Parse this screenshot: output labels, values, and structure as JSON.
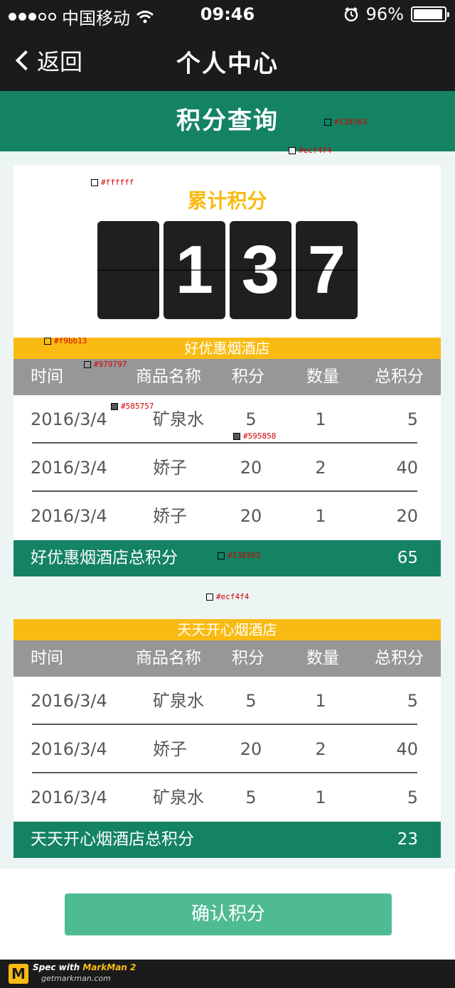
{
  "status_bar": {
    "carrier": "中国移动",
    "time": "09:46",
    "battery": "96%",
    "battery_level": 0.96,
    "signal_bars": 3,
    "signal_total": 5,
    "icons": [
      "signal-dots-icon",
      "wifi-icon",
      "alarm-icon",
      "battery-icon"
    ]
  },
  "nav": {
    "back_label": "返回",
    "title": "个人中心"
  },
  "subheader": {
    "title": "积分查询"
  },
  "summary": {
    "label": "累计积分",
    "digits": [
      "",
      "1",
      "3",
      "7"
    ]
  },
  "table_headers": {
    "time": "时间",
    "name": "商品名称",
    "points": "积分",
    "qty": "数量",
    "total": "总积分"
  },
  "stores": [
    {
      "name": "好优惠烟酒店",
      "rows": [
        {
          "time": "2016/3/4",
          "name": "矿泉水",
          "points": "5",
          "qty": "1",
          "total": "5"
        },
        {
          "time": "2016/3/4",
          "name": "娇子",
          "points": "20",
          "qty": "2",
          "total": "40"
        },
        {
          "time": "2016/3/4",
          "name": "娇子",
          "points": "20",
          "qty": "1",
          "total": "20"
        }
      ],
      "total_label": "好优惠烟酒店总积分",
      "total_value": "65"
    },
    {
      "name": "天天开心烟酒店",
      "rows": [
        {
          "time": "2016/3/4",
          "name": "矿泉水",
          "points": "5",
          "qty": "1",
          "total": "5"
        },
        {
          "time": "2016/3/4",
          "name": "娇子",
          "points": "20",
          "qty": "2",
          "total": "40"
        },
        {
          "time": "2016/3/4",
          "name": "矿泉水",
          "points": "5",
          "qty": "1",
          "total": "5"
        }
      ],
      "total_label": "天天开心烟酒店总积分",
      "total_value": "23"
    }
  ],
  "confirm_button": {
    "label": "确认积分"
  },
  "markman": {
    "line1_prefix": "Spec with ",
    "line1_brand": "MarkMan 2",
    "line2": "getmarkman.com",
    "logo_letter": "M"
  },
  "annotations": [
    {
      "text": "#138363",
      "color": "#138363"
    },
    {
      "text": "#ecf4f4",
      "color": "#ecf4f4"
    },
    {
      "text": "#ffffff",
      "color": "#ffffff"
    },
    {
      "text": "#f9bb13",
      "color": "#f9bb13"
    },
    {
      "text": "#979797",
      "color": "#979797"
    },
    {
      "text": "#585757",
      "color": "#585757"
    },
    {
      "text": "#595858",
      "color": "#595858"
    },
    {
      "text": "#138363",
      "color": "#138363"
    },
    {
      "text": "#ecf4f4",
      "color": "#ecf4f4"
    }
  ],
  "colors": {
    "primary_green": "#138363",
    "background": "#ecf4f4",
    "accent_yellow": "#f9bb13",
    "header_gray": "#979797",
    "text": "#585757",
    "divider": "#595858",
    "button": "#4fbb93"
  }
}
